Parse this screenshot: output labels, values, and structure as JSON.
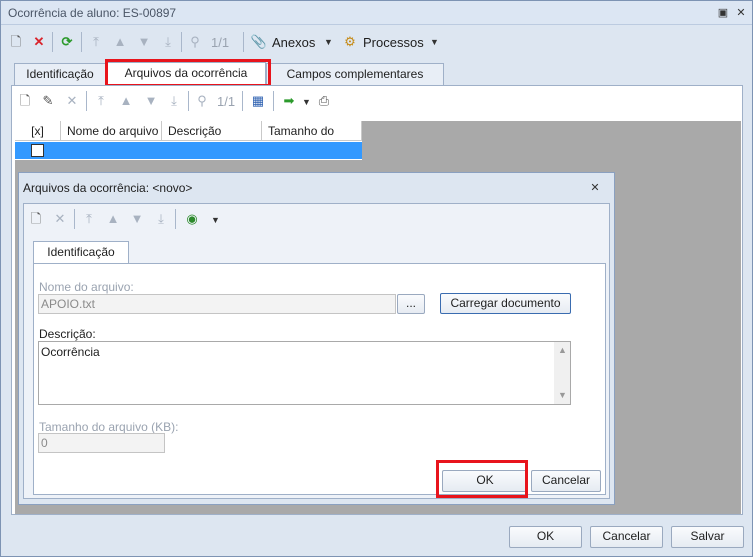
{
  "window": {
    "title": "Ocorrência de aluno: ES-00897"
  },
  "main_toolbar": {
    "page_indicator": "1/1",
    "attachments_label": "Anexos",
    "processes_label": "Processos"
  },
  "tabs": [
    {
      "label": "Identificação"
    },
    {
      "label": "Arquivos da ocorrência"
    },
    {
      "label": "Campos complementares"
    }
  ],
  "sub_toolbar": {
    "page_indicator": "1/1"
  },
  "grid": {
    "columns": [
      "[x]",
      "Nome do arquivo",
      "Descrição",
      "Tamanho do"
    ]
  },
  "dialog": {
    "title": "Arquivos da ocorrência: <novo>",
    "tab_label": "Identificação",
    "file_name_label": "Nome do arquivo:",
    "file_name_value": "APOIO.txt",
    "browse_label": "...",
    "load_button": "Carregar documento",
    "description_label": "Descrição:",
    "description_value": "Ocorrência",
    "size_label": "Tamanho do arquivo (KB):",
    "size_value": "0",
    "ok_button": "OK",
    "cancel_button": "Cancelar"
  },
  "footer": {
    "ok_button": "OK",
    "cancel_button": "Cancelar",
    "save_button": "Salvar"
  }
}
